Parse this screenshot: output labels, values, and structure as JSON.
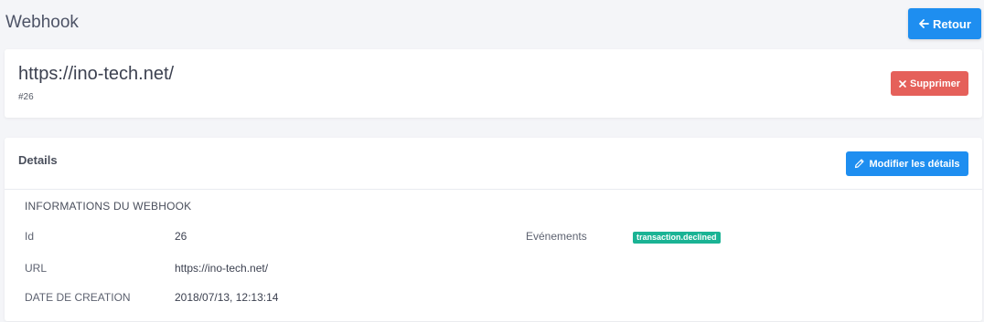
{
  "header": {
    "title": "Webhook",
    "back_label": "Retour"
  },
  "webhook": {
    "url_title": "https://ino-tech.net/",
    "id_label": "#26",
    "delete_label": "Supprimer"
  },
  "details": {
    "title": "Details",
    "edit_label": "Modifier les détails",
    "section_title": "INFORMATIONS DU WEBHOOK",
    "fields": {
      "id_label": "Id",
      "id_value": "26",
      "url_label": "URL",
      "url_value": "https://ino-tech.net/",
      "date_label": "DATE DE CREATION",
      "date_value": "2018/07/13, 12:13:14",
      "events_label": "Evénements",
      "events": [
        "transaction.declined"
      ]
    }
  },
  "colors": {
    "primary": "#1e8ef0",
    "danger": "#e5605a",
    "success": "#1ab394",
    "background": "#f4f5f8"
  },
  "icons": {
    "back": "arrow-left-icon",
    "delete": "close-icon",
    "edit": "pencil-icon"
  }
}
